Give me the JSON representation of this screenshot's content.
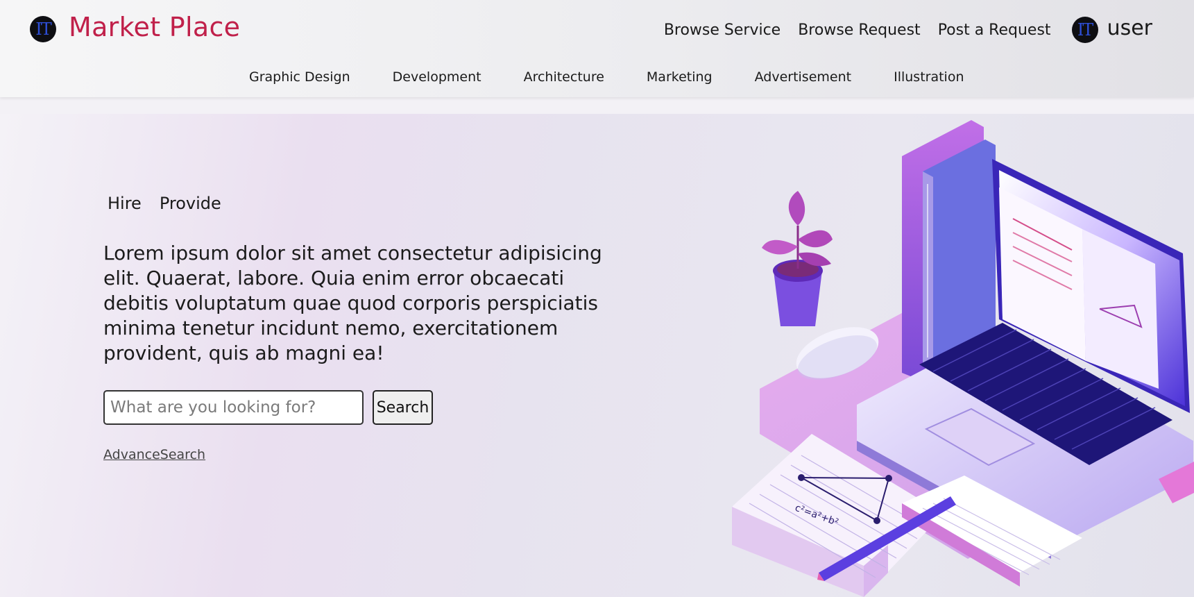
{
  "header": {
    "logo_text": "IT",
    "brand": "Market Place",
    "nav": [
      {
        "label": "Browse Service"
      },
      {
        "label": "Browse Request"
      },
      {
        "label": "Post a Request"
      }
    ],
    "user": {
      "avatar_text": "IT",
      "name": "user"
    },
    "categories": [
      "Graphic Design",
      "Development",
      "Architecture",
      "Marketing",
      "Advertisement",
      "Illustration"
    ]
  },
  "hero": {
    "tabs": [
      "Hire",
      "Provide"
    ],
    "lead": "Lorem ipsum dolor sit amet consectetur adipisicing elit. Quaerat, labore. Quia enim error obcaecati debitis voluptatum quae quod corporis perspiciatis minima tenetur incidunt nemo, exercitationem provident, quis ab magni ea!",
    "search": {
      "placeholder": "What are you looking for?",
      "value": "",
      "button": "Search"
    },
    "advanced_link": "AdvanceSearch"
  },
  "illustration": {
    "icon": "laptop-desk-illustration",
    "notebook_formula": "c²=a²+b²"
  },
  "colors": {
    "brand": "#c0204a",
    "avatar_bg": "#0e0e12",
    "avatar_text": "#2e4fd8",
    "accent_purple": "#8a3fd6"
  }
}
